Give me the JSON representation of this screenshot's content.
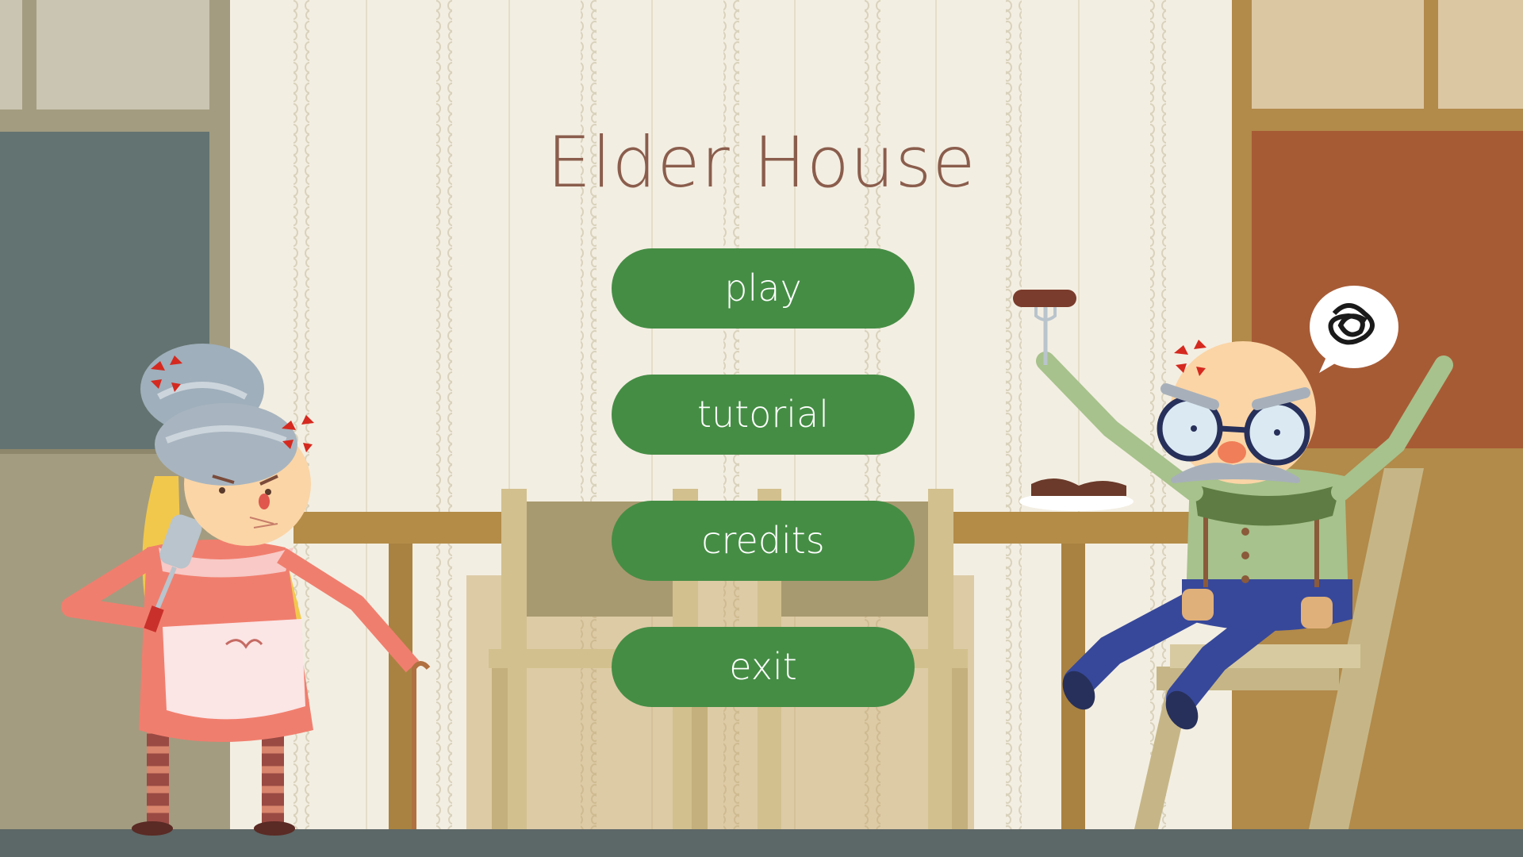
{
  "game": {
    "title": "Elder House"
  },
  "menu": {
    "items": [
      {
        "id": "play",
        "label": "play"
      },
      {
        "id": "tutorial",
        "label": "tutorial"
      },
      {
        "id": "credits",
        "label": "credits"
      },
      {
        "id": "exit",
        "label": "exit"
      }
    ]
  },
  "colors": {
    "wall": "#f3eee2",
    "wall_pattern": "#d9d2bc",
    "title_text": "#8a5d4c",
    "button_bg": "#458d45",
    "button_text": "#ffffff",
    "floor": "#5c6767",
    "table_wood": "#b48c48",
    "chair_wood": "#d2c08e",
    "chair_back": "#a89a70",
    "door_frame_left": "#a39c80",
    "door_glass_left": "#637371",
    "door_frame_right": "#b28a4a",
    "door_panel_right": "#a75b35"
  },
  "characters": [
    {
      "name": "grandma",
      "emotion": "angry",
      "holds": "spatula-icon",
      "accessory": "cane-icon"
    },
    {
      "name": "grandpa",
      "emotion": "angry",
      "holds": "fork-with-sausage-icon",
      "thought": "scribble-thought-icon"
    }
  ]
}
